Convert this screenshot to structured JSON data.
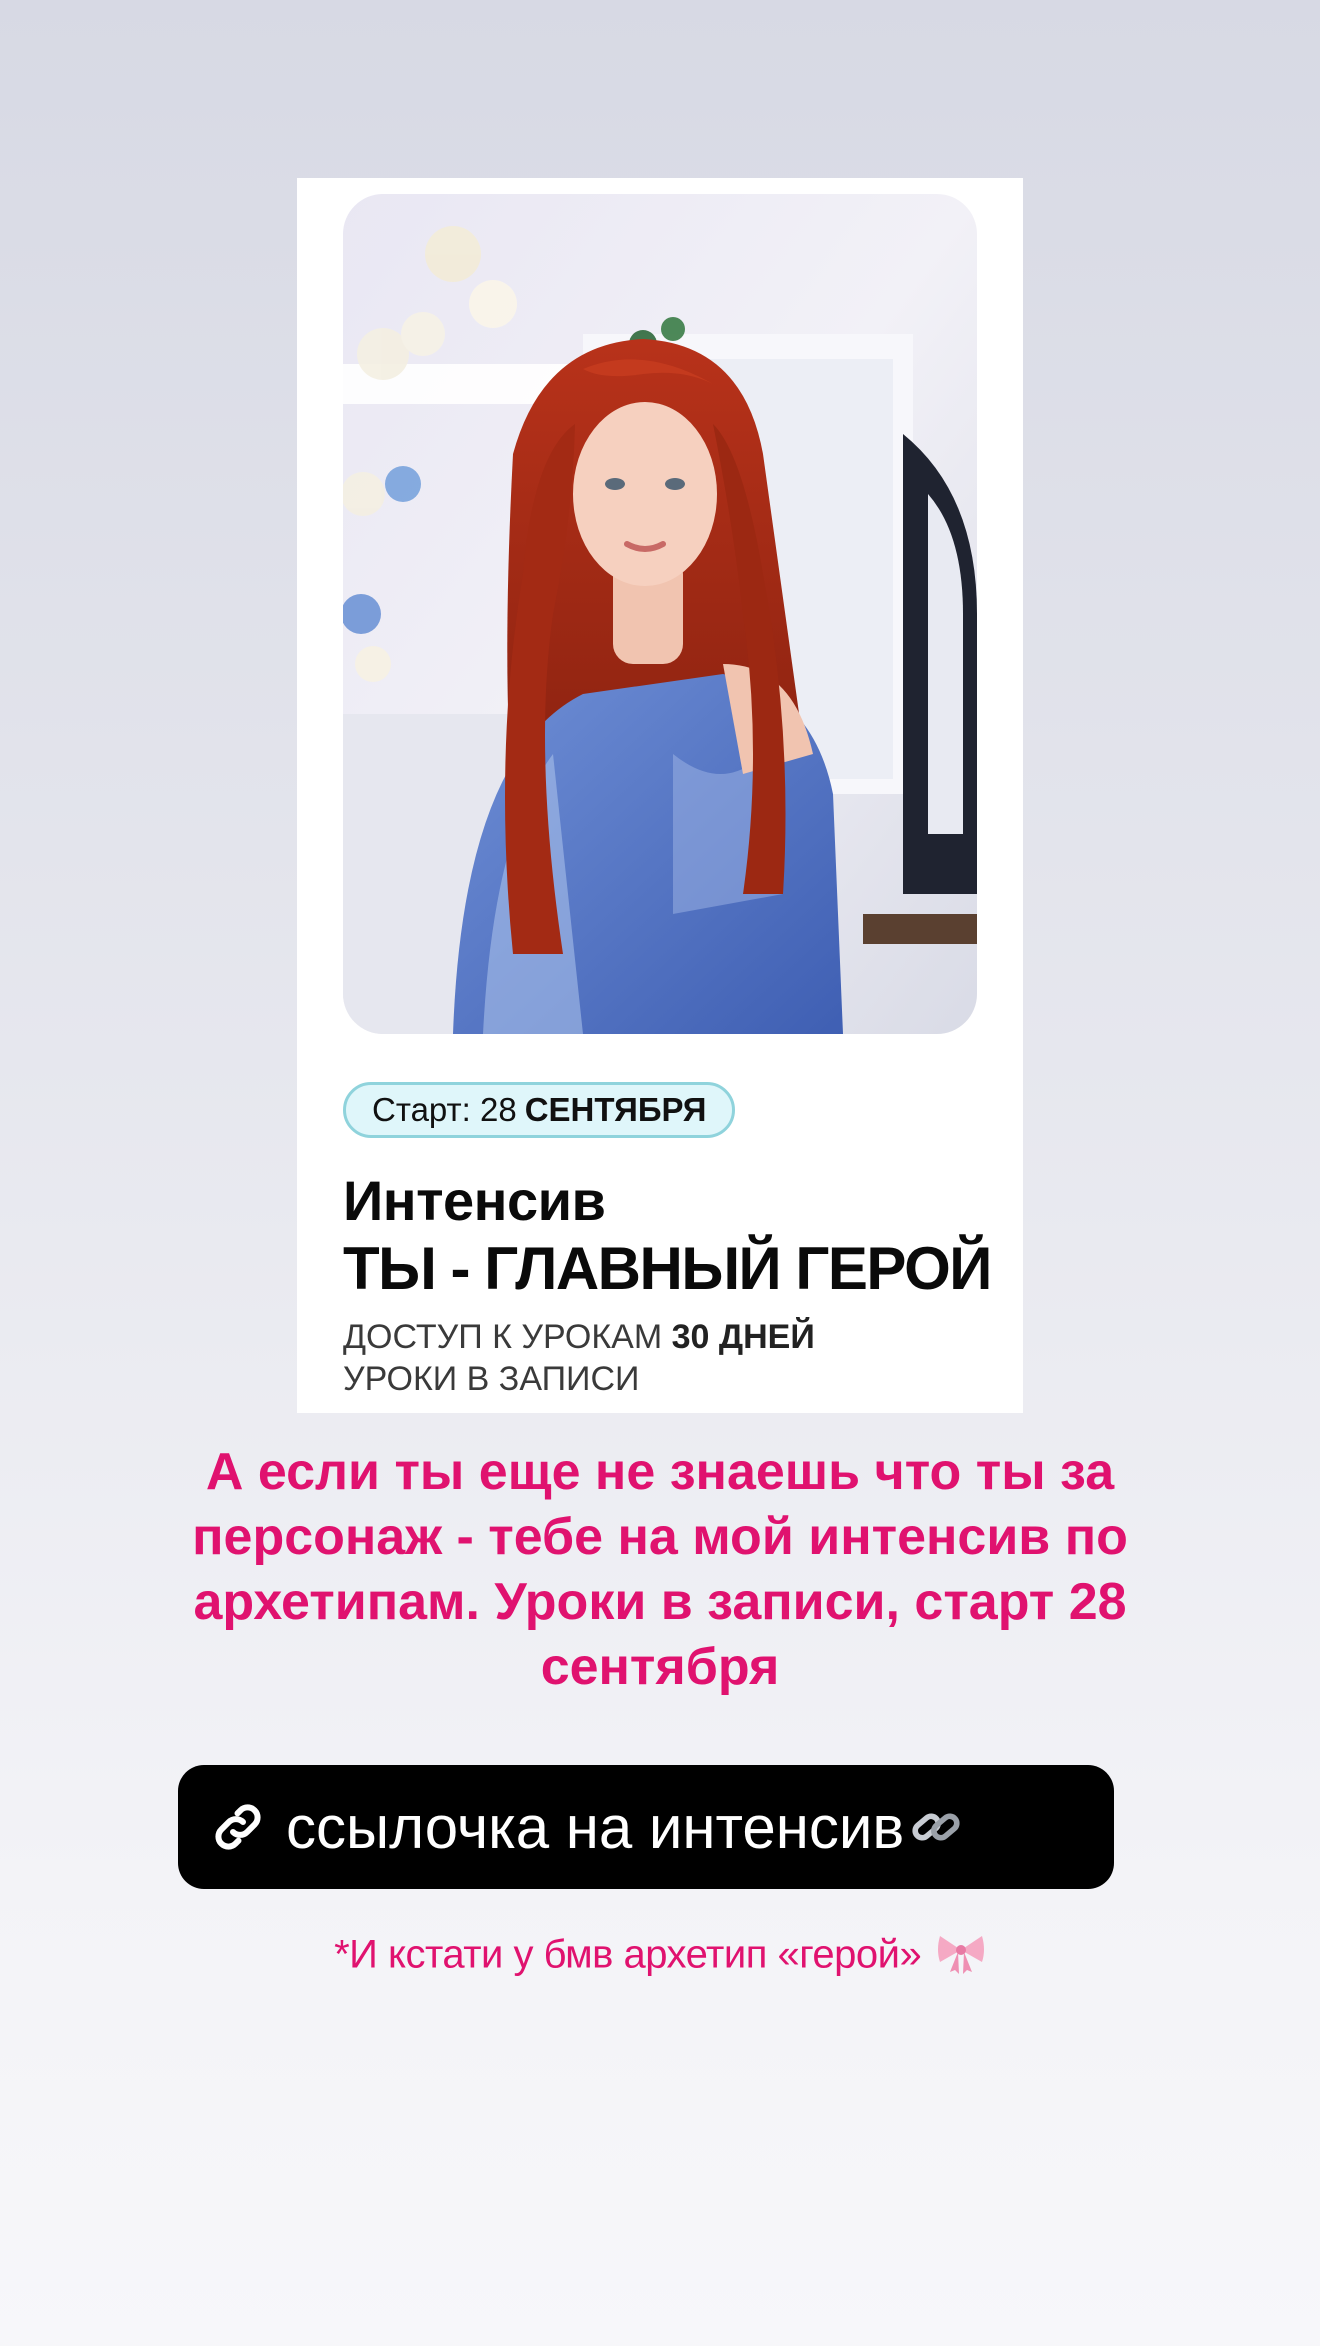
{
  "card": {
    "photo_alt": "portrait",
    "badge_prefix": "Старт: 28",
    "badge_month": "СЕНТЯБРЯ",
    "title_line1": "Интенсив",
    "title_line2": "ТЫ - ГЛАВНЫЙ ГЕРОЙ",
    "access_prefix": "ДОСТУП К УРОКАМ",
    "access_days": "30 ДНЕЙ",
    "lessons_note": "УРОКИ В ЗАПИСИ"
  },
  "headline": "А если ты еще не знаешь что ты за персонаж - тебе на мой интенсив по архетипам. Уроки в записи, старт 28 сентября",
  "link_button": {
    "label": "ссылочка на интенсив",
    "lead_icon": "link-icon",
    "trail_icon": "link-icon"
  },
  "note": "*И кстати у бмв архетип «герой»",
  "note_icon": "ribbon-icon",
  "colors": {
    "accent_pink": "#e0126f",
    "badge_bg": "#dff6fa",
    "badge_border": "#8fd3dc",
    "button_bg": "#000000"
  }
}
